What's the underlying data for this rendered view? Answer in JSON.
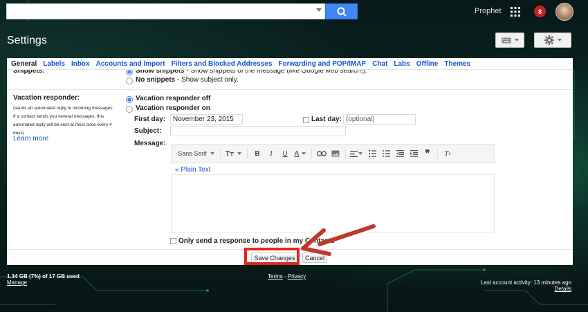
{
  "header": {
    "user_name": "Prophet",
    "notification_count": "8"
  },
  "page": {
    "title": "Settings"
  },
  "tabs": [
    {
      "label": "General",
      "active": true
    },
    {
      "label": "Labels"
    },
    {
      "label": "Inbox"
    },
    {
      "label": "Accounts and Import"
    },
    {
      "label": "Filters and Blocked Addresses"
    },
    {
      "label": "Forwarding and POP/IMAP"
    },
    {
      "label": "Chat"
    },
    {
      "label": "Labs"
    },
    {
      "label": "Offline"
    },
    {
      "label": "Themes"
    }
  ],
  "snippets": {
    "label": "Snippets:",
    "show_bold": "Show snippets",
    "show_rest": " - Show snippets of the message (like Google web search!).",
    "none_bold": "No snippets",
    "none_rest": " - Show subject only."
  },
  "vacation": {
    "label": "Vacation responder:",
    "help": "(sends an automated reply to incoming messages. If a contact sends you several messages, this automated reply will be sent at most once every 4 days)",
    "learn_more": "Learn more",
    "off_label": "Vacation responder off",
    "on_label": "Vacation responder on",
    "first_day_label": "First day:",
    "first_day_value": "November 23, 2015",
    "last_day_label": "Last day:",
    "last_day_placeholder": "(optional)",
    "subject_label": "Subject:",
    "subject_value": "",
    "message_label": "Message:",
    "font_name": "Sans Serif",
    "plain_text_link": "« Plain Text",
    "contacts_only_label": "Only send a response to people in my Contacts"
  },
  "actions": {
    "save_label": "Save Changes",
    "cancel_label": "Cancel"
  },
  "footer": {
    "storage": "1.34 GB (7%) of 17 GB used",
    "manage": "Manage",
    "terms": "Terms",
    "dash": " - ",
    "privacy": "Privacy",
    "last_activity": "Last account activity: 13 minutes ago",
    "details": "Details"
  },
  "colors": {
    "accent_blue": "#4285f4",
    "link_blue": "#1155cc",
    "highlight_red": "#e0271c",
    "arrow_red": "#c0392b"
  }
}
